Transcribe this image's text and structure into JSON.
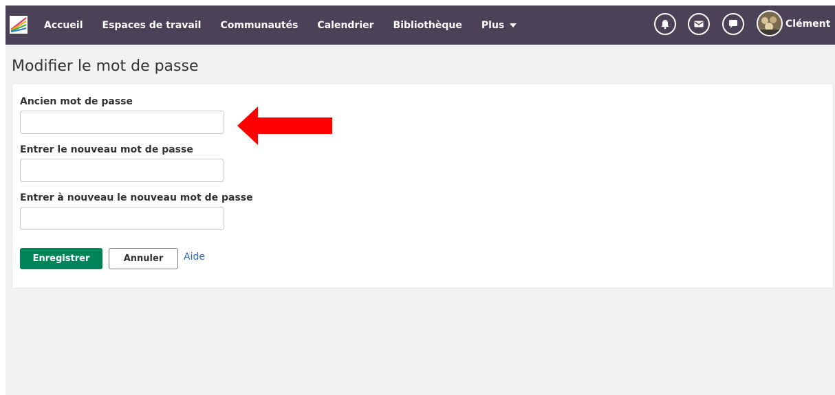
{
  "topbar": {
    "bg_color": "#4b4258",
    "nav": [
      {
        "label": "Accueil"
      },
      {
        "label": "Espaces de travail"
      },
      {
        "label": "Communautés"
      },
      {
        "label": "Calendrier"
      },
      {
        "label": "Bibliothèque"
      },
      {
        "label": "Plus",
        "has_dropdown": true
      }
    ],
    "icons": [
      "bell-icon",
      "mail-icon",
      "chat-icon"
    ],
    "user": {
      "name": "Clément"
    }
  },
  "page": {
    "title": "Modifier le mot de passe"
  },
  "form": {
    "fields": [
      {
        "label": "Ancien mot de passe",
        "value": ""
      },
      {
        "label": "Entrer le nouveau mot de passe",
        "value": ""
      },
      {
        "label": "Entrer à nouveau le nouveau mot de passe",
        "value": ""
      }
    ],
    "save_label": "Enregistrer",
    "cancel_label": "Annuler",
    "help_label": "Aide"
  },
  "colors": {
    "primary_button": "#00845a",
    "link": "#2c6bb3",
    "annotation_arrow": "#ff0000",
    "page_bg": "#f2f2f3"
  }
}
